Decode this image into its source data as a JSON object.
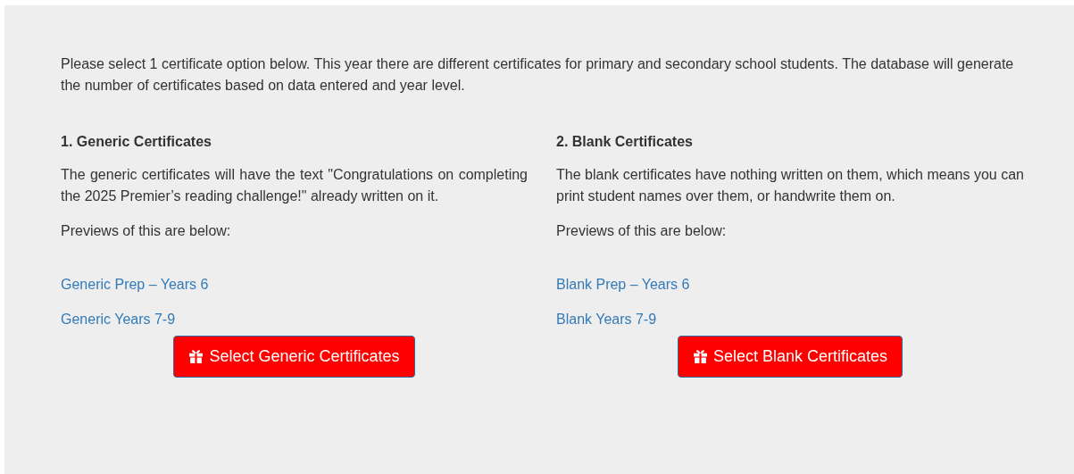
{
  "intro": "Please select 1 certificate option below. This year there are different certificates for primary and secondary school students. The database will generate the number of certificates based on data entered and year level.",
  "options": [
    {
      "heading": "1. Generic Certificates",
      "description": "The generic certificates will have the text \"Congratulations on completing the 2025 Premier’s reading challenge!\" already written on it.",
      "previews_label": "Previews of this are below:",
      "links": [
        "Generic Prep – Years 6",
        "Generic Years 7-9"
      ],
      "button": "Select Generic Certificates"
    },
    {
      "heading": "2. Blank Certificates",
      "description": "The blank certificates have nothing written on them, which means you can print student names over them, or handwrite them on.",
      "previews_label": "Previews of this are below:",
      "links": [
        "Blank Prep – Years 6",
        "Blank Years 7-9"
      ],
      "button": "Select Blank Certificates"
    }
  ]
}
